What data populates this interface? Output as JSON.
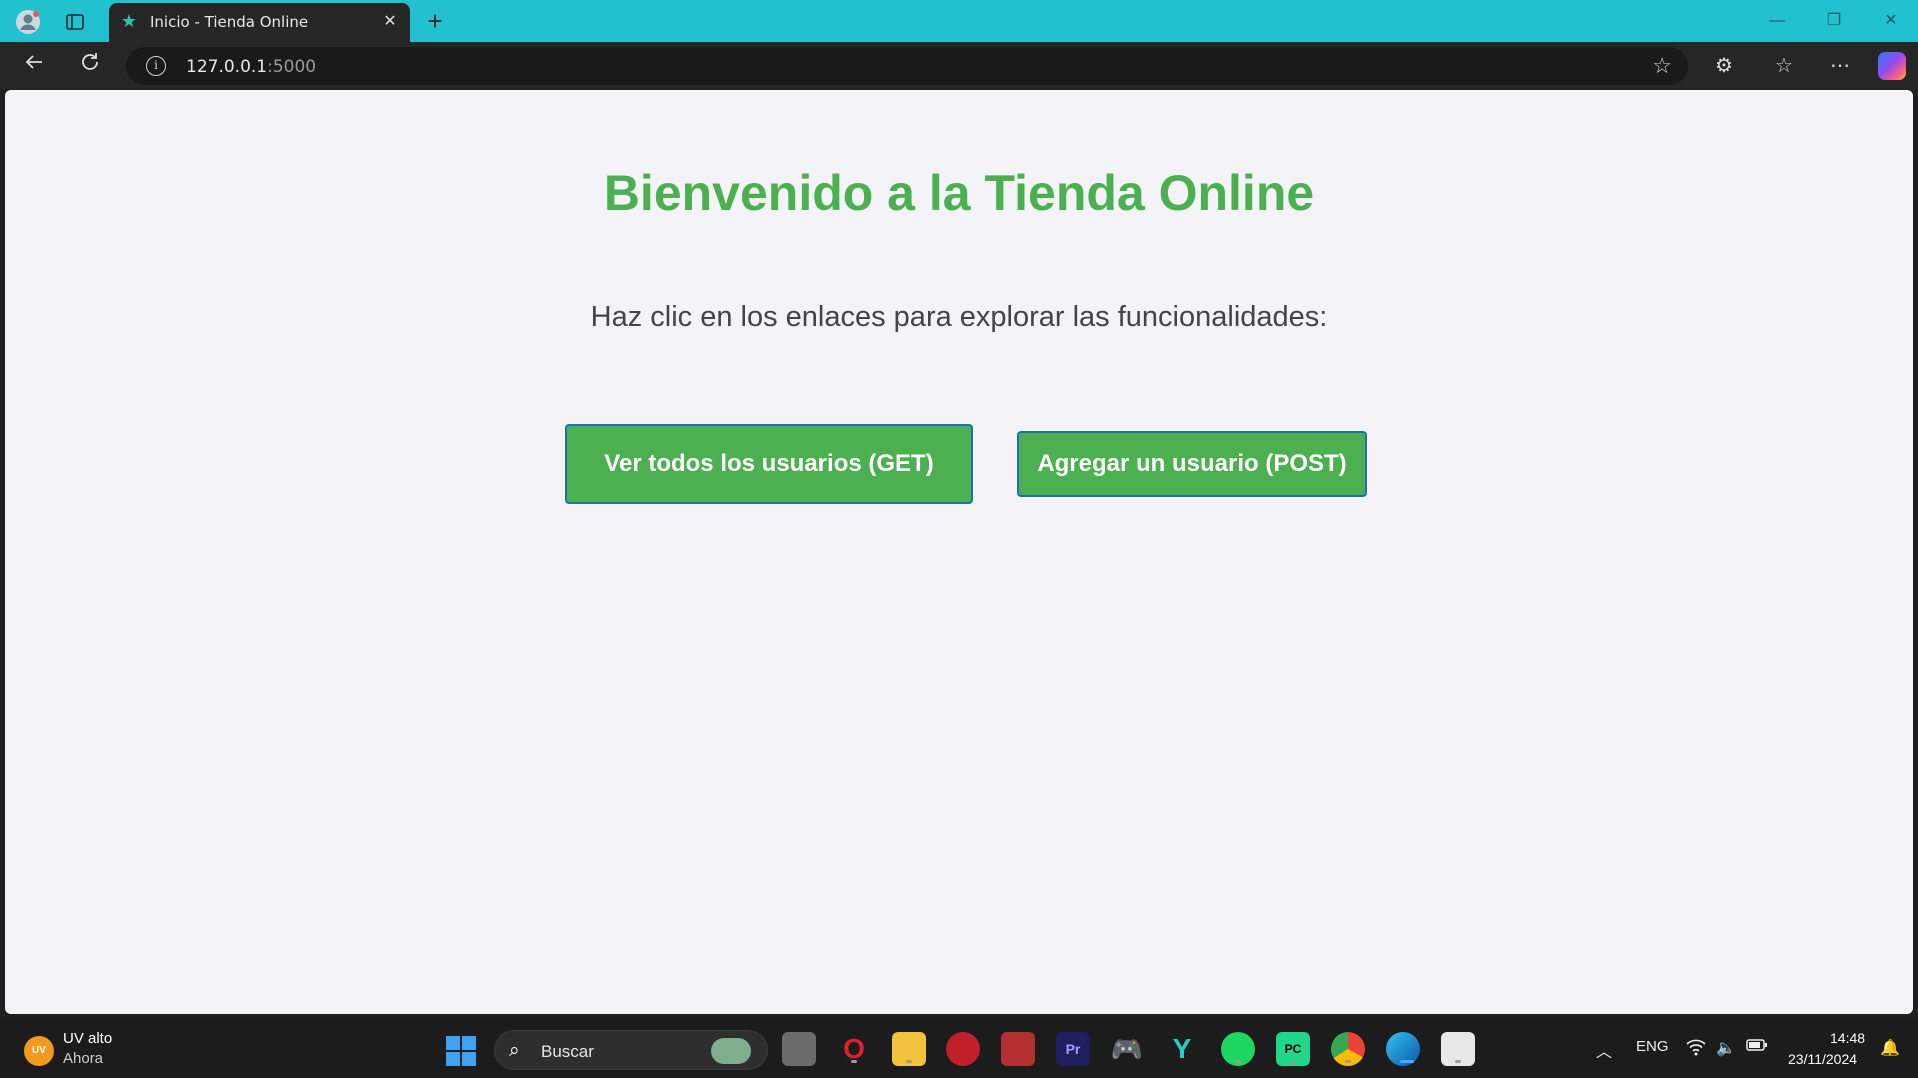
{
  "browser": {
    "tab_title": "Inicio - Tienda Online",
    "url_host": "127.0.0.1",
    "url_port": ":5000"
  },
  "page": {
    "title": "Bienvenido a la Tienda Online",
    "subtitle": "Haz clic en los enlaces para explorar las funcionalidades:",
    "buttons": [
      {
        "label": "Ver todos los usuarios (GET)"
      },
      {
        "label": "Agregar un usuario (POST)"
      }
    ],
    "accent_color": "#4caf50"
  },
  "taskbar": {
    "weather_badge": "UV",
    "weather_title": "UV alto",
    "weather_subtitle": "Ahora",
    "search_placeholder": "Buscar",
    "language": "ENG",
    "time": "14:48",
    "date": "23/11/2024",
    "apps": [
      "task-view",
      "opera",
      "file-explorer",
      "app-red",
      "app-game",
      "premiere-pro",
      "game-controller",
      "app-y",
      "spotify",
      "pycharm",
      "chrome",
      "edge",
      "app-tool"
    ]
  }
}
